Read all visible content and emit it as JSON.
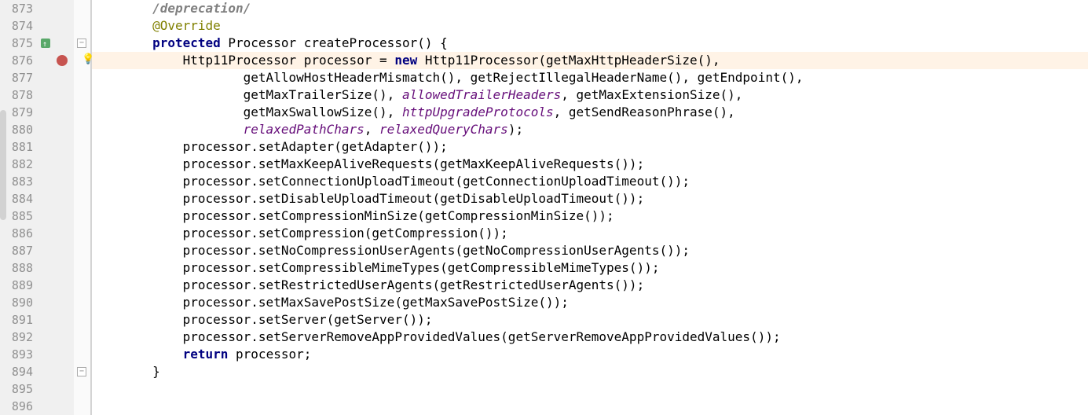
{
  "editor": {
    "gutter": {
      "lines": [
        "873",
        "874",
        "875",
        "876",
        "877",
        "878",
        "879",
        "880",
        "881",
        "882",
        "883",
        "884",
        "885",
        "886",
        "887",
        "888",
        "889",
        "890",
        "891",
        "892",
        "893",
        "894",
        "895",
        "896"
      ],
      "breakpoint_line": 876,
      "bulb_line": 876,
      "override_line": 875,
      "fold_open_line": 875,
      "fold_close_line": 894
    },
    "code": {
      "l873": {
        "indent": "        ",
        "tokens": [
          {
            "cls": "cmt",
            "t": "/deprecation/"
          }
        ]
      },
      "l874": {
        "indent": "        ",
        "tokens": [
          {
            "cls": "ann",
            "t": "@Override"
          }
        ]
      },
      "l875": {
        "indent": "        ",
        "tokens": [
          {
            "cls": "kw",
            "t": "protected "
          },
          {
            "cls": "plain",
            "t": "Processor createProcessor() {"
          }
        ]
      },
      "l876": {
        "indent": "            ",
        "highlight": true,
        "tokens": [
          {
            "cls": "plain",
            "t": "Http11Processor processor = "
          },
          {
            "cls": "kw",
            "t": "new "
          },
          {
            "cls": "plain",
            "t": "Http11Processor(getMaxHttpHeaderSize(),"
          }
        ]
      },
      "l877": {
        "indent": "                    ",
        "tokens": [
          {
            "cls": "plain",
            "t": "getAllowHostHeaderMismatch(), getRejectIllegalHeaderName(), getEndpoint(),"
          }
        ]
      },
      "l878": {
        "indent": "                    ",
        "tokens": [
          {
            "cls": "plain",
            "t": "getMaxTrailerSize(), "
          },
          {
            "cls": "field",
            "t": "allowedTrailerHeaders"
          },
          {
            "cls": "plain",
            "t": ", getMaxExtensionSize(),"
          }
        ]
      },
      "l879": {
        "indent": "                    ",
        "tokens": [
          {
            "cls": "plain",
            "t": "getMaxSwallowSize(), "
          },
          {
            "cls": "field",
            "t": "httpUpgradeProtocols"
          },
          {
            "cls": "plain",
            "t": ", getSendReasonPhrase(),"
          }
        ]
      },
      "l880": {
        "indent": "                    ",
        "tokens": [
          {
            "cls": "field",
            "t": "relaxedPathChars"
          },
          {
            "cls": "plain",
            "t": ", "
          },
          {
            "cls": "field",
            "t": "relaxedQueryChars"
          },
          {
            "cls": "plain",
            "t": ");"
          }
        ]
      },
      "l881": {
        "indent": "            ",
        "tokens": [
          {
            "cls": "plain",
            "t": "processor.setAdapter(getAdapter());"
          }
        ]
      },
      "l882": {
        "indent": "            ",
        "tokens": [
          {
            "cls": "plain",
            "t": "processor.setMaxKeepAliveRequests(getMaxKeepAliveRequests());"
          }
        ]
      },
      "l883": {
        "indent": "            ",
        "tokens": [
          {
            "cls": "plain",
            "t": "processor.setConnectionUploadTimeout(getConnectionUploadTimeout());"
          }
        ]
      },
      "l884": {
        "indent": "            ",
        "tokens": [
          {
            "cls": "plain",
            "t": "processor.setDisableUploadTimeout(getDisableUploadTimeout());"
          }
        ]
      },
      "l885": {
        "indent": "            ",
        "tokens": [
          {
            "cls": "plain",
            "t": "processor.setCompressionMinSize(getCompressionMinSize());"
          }
        ]
      },
      "l886": {
        "indent": "            ",
        "tokens": [
          {
            "cls": "plain",
            "t": "processor.setCompression(getCompression());"
          }
        ]
      },
      "l887": {
        "indent": "            ",
        "tokens": [
          {
            "cls": "plain",
            "t": "processor.setNoCompressionUserAgents(getNoCompressionUserAgents());"
          }
        ]
      },
      "l888": {
        "indent": "            ",
        "tokens": [
          {
            "cls": "plain",
            "t": "processor.setCompressibleMimeTypes(getCompressibleMimeTypes());"
          }
        ]
      },
      "l889": {
        "indent": "            ",
        "tokens": [
          {
            "cls": "plain",
            "t": "processor.setRestrictedUserAgents(getRestrictedUserAgents());"
          }
        ]
      },
      "l890": {
        "indent": "            ",
        "tokens": [
          {
            "cls": "plain",
            "t": "processor.setMaxSavePostSize(getMaxSavePostSize());"
          }
        ]
      },
      "l891": {
        "indent": "            ",
        "tokens": [
          {
            "cls": "plain",
            "t": "processor.setServer(getServer());"
          }
        ]
      },
      "l892": {
        "indent": "            ",
        "tokens": [
          {
            "cls": "plain",
            "t": "processor.setServerRemoveAppProvidedValues(getServerRemoveAppProvidedValues());"
          }
        ]
      },
      "l893": {
        "indent": "            ",
        "tokens": [
          {
            "cls": "kw",
            "t": "return "
          },
          {
            "cls": "plain",
            "t": "processor;"
          }
        ]
      },
      "l894": {
        "indent": "        ",
        "tokens": [
          {
            "cls": "plain",
            "t": "}"
          }
        ]
      },
      "l895": {
        "indent": "",
        "tokens": [
          {
            "cls": "plain",
            "t": ""
          }
        ]
      },
      "l896": {
        "indent": "",
        "tokens": [
          {
            "cls": "plain",
            "t": ""
          }
        ]
      }
    }
  }
}
